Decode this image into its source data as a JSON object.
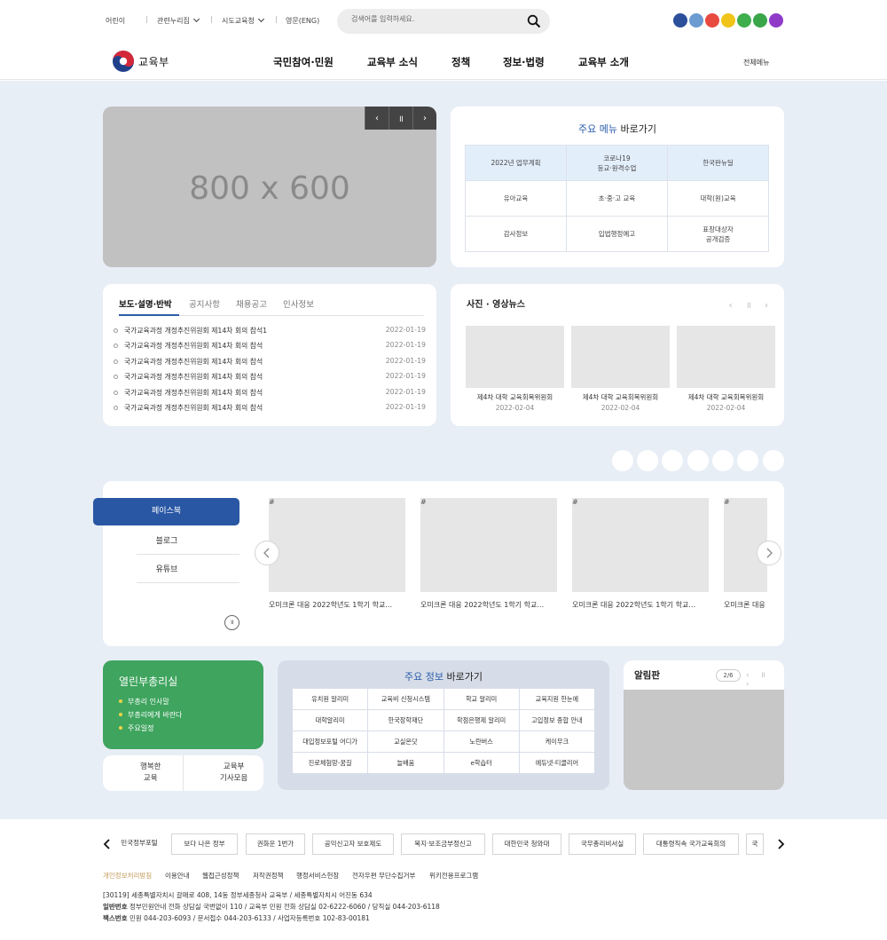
{
  "util": {
    "links": [
      "어린이",
      "관련누리집",
      "시도교육청",
      "영문(ENG)"
    ],
    "search_placeholder": "검색어를 입력하세요.",
    "color_dots": [
      "#2b4f9b",
      "#6b9bd1",
      "#e84a3f",
      "#f0c419",
      "#3fae4d",
      "#3aa64a",
      "#8f3bc8"
    ]
  },
  "gnb": {
    "logo": "교육부",
    "items": [
      "국민참여·민원",
      "교육부 소식",
      "정책",
      "정보·법령",
      "교육부 소개"
    ],
    "all_menu": "전체메뉴"
  },
  "visual": {
    "placeholder_text": "800 x 600",
    "controls": [
      "‹",
      "॥",
      "›"
    ]
  },
  "quick_menu": {
    "title_em": "주요 메뉴",
    "title_rest": " 바로가기",
    "cells": [
      [
        "2022년 업무계획",
        "코로나19\n등교·원격수업",
        "한국판뉴딜"
      ],
      [
        "유아교육",
        "초·중·고 교육",
        "대학(원)교육"
      ],
      [
        "감사정보",
        "입법행정예고",
        "표창대상자\n공개검증"
      ]
    ]
  },
  "press": {
    "tabs": [
      "보도·설명·반박",
      "공지사항",
      "채용공고",
      "인사정보"
    ],
    "items": [
      {
        "title": "국가교육과정 개정추진위원회 제14차 회의 참석1",
        "date": "2022-01-19"
      },
      {
        "title": "국가교육과정 개정추진위원회 제14차 회의 참석",
        "date": "2022-01-19"
      },
      {
        "title": "국가교육과정 개정추진위원회 제14차 회의 참석",
        "date": "2022-01-19"
      },
      {
        "title": "국가교육과정 개정추진위원회 제14차 회의 참석",
        "date": "2022-01-19"
      },
      {
        "title": "국가교육과정 개정추진위원회 제14차 회의 참석",
        "date": "2022-01-19"
      },
      {
        "title": "국가교육과정 개정추진위원회 제14차 회의 참석",
        "date": "2022-01-19"
      }
    ]
  },
  "photo_news": {
    "title": "사진 · 영상뉴스",
    "controls": "‹ ॥ ›",
    "items": [
      {
        "caption": "제4차 대학 교육회복위원회",
        "date": "2022-02-04"
      },
      {
        "caption": "제4차 대학 교육회복위원회",
        "date": "2022-02-04"
      },
      {
        "caption": "제4차 대학 교육회복위원회",
        "date": "2022-02-04"
      }
    ]
  },
  "sns": {
    "tabs": [
      "페이스북",
      "블로그",
      "유튜브"
    ],
    "broken_alt": "#",
    "captions": [
      "오미크론 대응 2022학년도 1학기 학교…",
      "오미크론 대응 2022학년도 1학기 학교…",
      "오미크론 대응 2022학년도 1학기 학교…",
      "오미크론 대응"
    ],
    "pause": "॥"
  },
  "briefing": {
    "title": "열린부총리실",
    "items": [
      "부총리 인사말",
      "부총리에게 바란다",
      "주요일정"
    ],
    "happy_left": "행복한\n교육",
    "happy_right": "교육부\n기사모음"
  },
  "info_links": {
    "title_em": "주요 정보",
    "title_rest": " 바로가기",
    "cells": [
      [
        "유치원 알리미",
        "교육비 신청시스템",
        "학교 알리미",
        "교육지원 한눈에"
      ],
      [
        "대학알리미",
        "한국장학재단",
        "학점은행제 알리미",
        "고입정보 종합 안내"
      ],
      [
        "대입정보포털 어디가",
        "교실온닷",
        "노란버스",
        "케이무크"
      ],
      [
        "진로체험망-꿈길",
        "늘배움",
        "e학습터",
        "에듀넷·티클리어"
      ]
    ]
  },
  "board": {
    "title": "알림판",
    "page": "2/6",
    "controls": "‹ ॥ ›"
  },
  "footer": {
    "sites": [
      "민국정부포털",
      "보다 나은 정부",
      "권화운 1번가",
      "공익신고자 보호제도",
      "복지·보조금부정신고",
      "대한민국 청와대",
      "국무총리비서실",
      "대통령직속 국가교육회의",
      "국"
    ],
    "policies": [
      "개인정보처리방침",
      "이용안내",
      "웹접근성정책",
      "저작권정책",
      "행정서비스헌장",
      "전자우편 무단수집거부",
      "위키전용프로그램"
    ],
    "addr1": "[30119] 세종특별자치시 갈매로 408, 14동 정부세종청사 교육부 / 세종특별자치시 어진동 634",
    "addr2_label": "일반번호",
    "addr2": " 정부민원안내 전화 상담실 국번없이 110 / 교육부 민원 전화 상담실 02-6222-6060 / 당직실 044-203-6118",
    "addr3_label": "팩스번호",
    "addr3": " 민원 044-203-6093 / 문서접수 044-203-6133 / 사업자등록번호 102-83-00181"
  }
}
